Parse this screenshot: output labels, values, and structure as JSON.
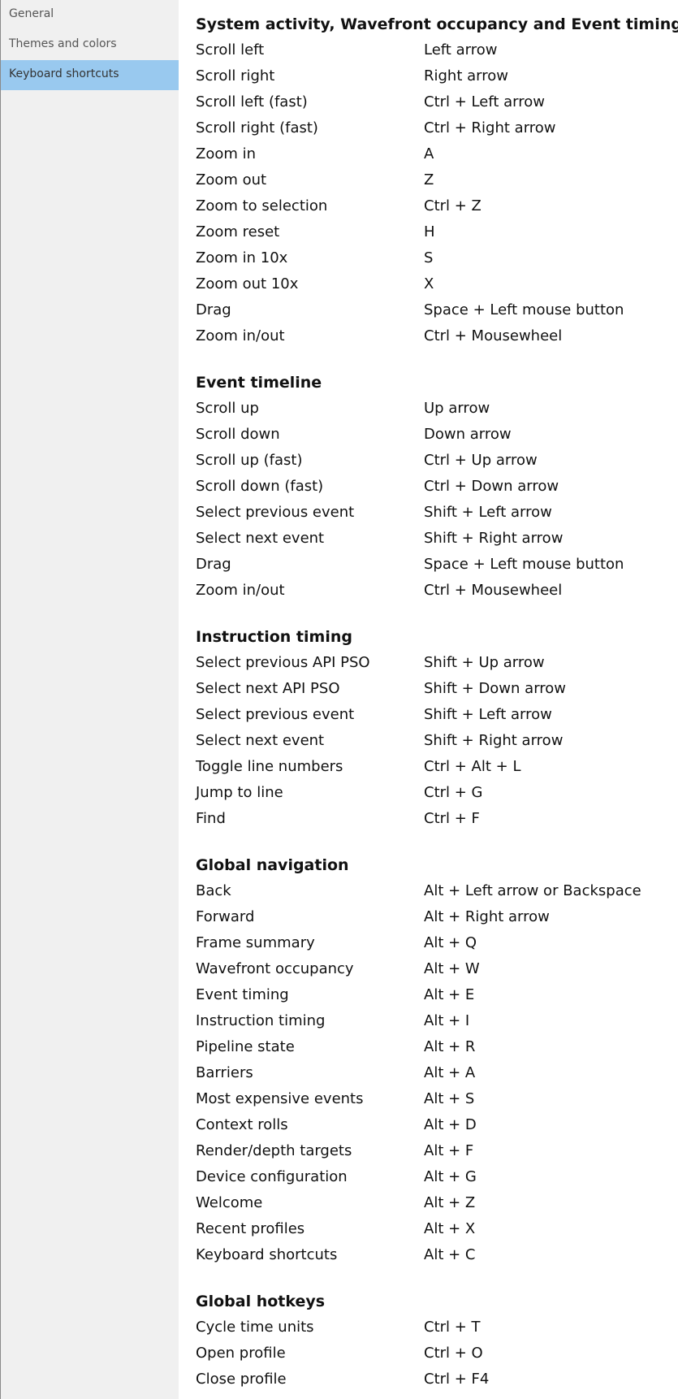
{
  "sidebar": {
    "items": [
      {
        "label": "General",
        "selected": false
      },
      {
        "label": "Themes and colors",
        "selected": false
      },
      {
        "label": "Keyboard shortcuts",
        "selected": true
      }
    ]
  },
  "sections": [
    {
      "title": "System activity, Wavefront occupancy and Event timing",
      "rows": [
        {
          "action": "Scroll left",
          "keys": "Left arrow"
        },
        {
          "action": "Scroll right",
          "keys": "Right arrow"
        },
        {
          "action": "Scroll left (fast)",
          "keys": "Ctrl + Left arrow"
        },
        {
          "action": "Scroll right (fast)",
          "keys": "Ctrl + Right arrow"
        },
        {
          "action": "Zoom in",
          "keys": "A"
        },
        {
          "action": "Zoom out",
          "keys": "Z"
        },
        {
          "action": "Zoom to selection",
          "keys": "Ctrl + Z"
        },
        {
          "action": "Zoom reset",
          "keys": "H"
        },
        {
          "action": "Zoom in 10x",
          "keys": "S"
        },
        {
          "action": "Zoom out 10x",
          "keys": "X"
        },
        {
          "action": "Drag",
          "keys": "Space + Left mouse button"
        },
        {
          "action": "Zoom in/out",
          "keys": "Ctrl + Mousewheel"
        }
      ]
    },
    {
      "title": "Event timeline",
      "rows": [
        {
          "action": "Scroll up",
          "keys": "Up arrow"
        },
        {
          "action": "Scroll down",
          "keys": "Down arrow"
        },
        {
          "action": "Scroll up (fast)",
          "keys": "Ctrl + Up arrow"
        },
        {
          "action": "Scroll down (fast)",
          "keys": "Ctrl + Down arrow"
        },
        {
          "action": "Select previous event",
          "keys": "Shift + Left arrow"
        },
        {
          "action": "Select next event",
          "keys": "Shift + Right arrow"
        },
        {
          "action": "Drag",
          "keys": "Space + Left mouse button"
        },
        {
          "action": "Zoom in/out",
          "keys": "Ctrl + Mousewheel"
        }
      ]
    },
    {
      "title": "Instruction timing",
      "rows": [
        {
          "action": "Select previous API PSO",
          "keys": "Shift + Up arrow"
        },
        {
          "action": "Select next API PSO",
          "keys": "Shift + Down arrow"
        },
        {
          "action": "Select previous event",
          "keys": "Shift + Left arrow"
        },
        {
          "action": "Select next event",
          "keys": "Shift + Right arrow"
        },
        {
          "action": "Toggle line numbers",
          "keys": "Ctrl + Alt + L"
        },
        {
          "action": "Jump to line",
          "keys": "Ctrl + G"
        },
        {
          "action": "Find",
          "keys": "Ctrl + F"
        }
      ]
    },
    {
      "title": "Global navigation",
      "rows": [
        {
          "action": "Back",
          "keys": "Alt + Left arrow or Backspace"
        },
        {
          "action": "Forward",
          "keys": "Alt + Right arrow"
        },
        {
          "action": "Frame summary",
          "keys": "Alt + Q"
        },
        {
          "action": "Wavefront occupancy",
          "keys": "Alt + W"
        },
        {
          "action": "Event timing",
          "keys": "Alt + E"
        },
        {
          "action": "Instruction timing",
          "keys": "Alt + I"
        },
        {
          "action": "Pipeline state",
          "keys": "Alt + R"
        },
        {
          "action": "Barriers",
          "keys": "Alt + A"
        },
        {
          "action": "Most expensive events",
          "keys": "Alt + S"
        },
        {
          "action": "Context rolls",
          "keys": "Alt + D"
        },
        {
          "action": "Render/depth targets",
          "keys": "Alt + F"
        },
        {
          "action": "Device configuration",
          "keys": "Alt + G"
        },
        {
          "action": "Welcome",
          "keys": "Alt + Z"
        },
        {
          "action": "Recent profiles",
          "keys": "Alt + X"
        },
        {
          "action": "Keyboard shortcuts",
          "keys": "Alt + C"
        }
      ]
    },
    {
      "title": "Global hotkeys",
      "rows": [
        {
          "action": "Cycle time units",
          "keys": "Ctrl + T"
        },
        {
          "action": "Open profile",
          "keys": "Ctrl + O"
        },
        {
          "action": "Close profile",
          "keys": "Ctrl + F4"
        }
      ]
    }
  ]
}
